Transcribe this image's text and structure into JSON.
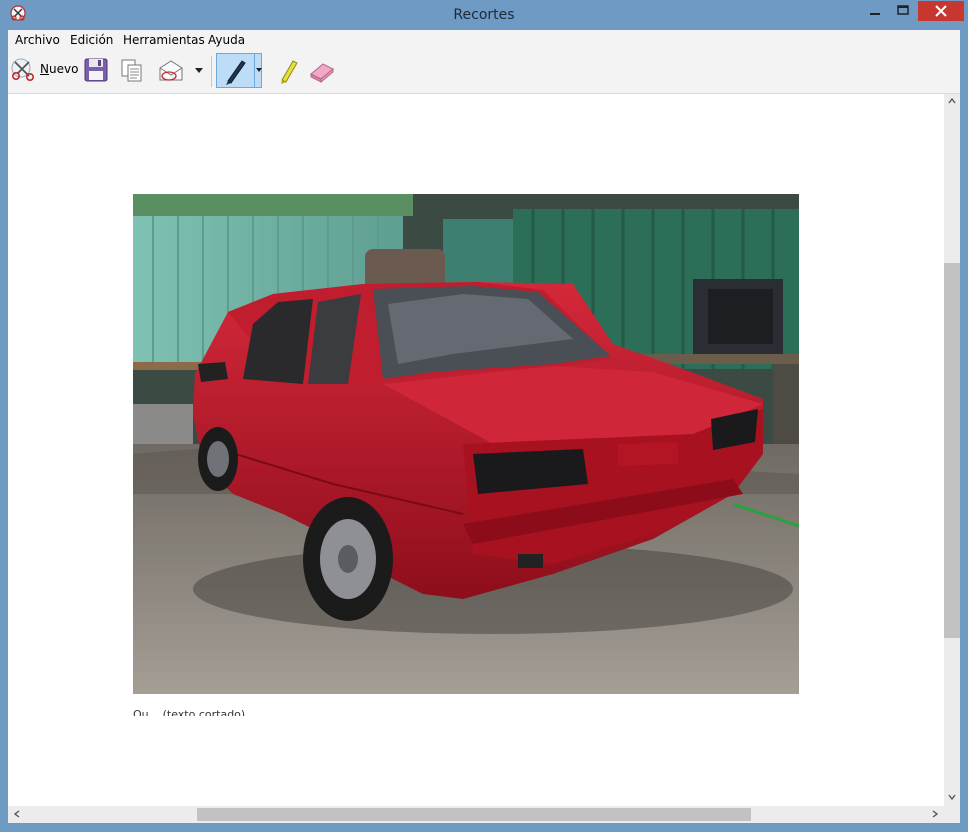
{
  "window": {
    "title": "Recortes"
  },
  "menu": [
    "Archivo",
    "Edición",
    "Herramientas",
    "Ayuda"
  ],
  "toolbar": {
    "nuevo_label": "Nuevo",
    "nuevo_underline": "N",
    "nuevo_rest": "uevo",
    "active_tool": "pen-icon"
  },
  "canvas": {
    "caption_partial": "Qu...  (texto cortado)"
  },
  "colors": {
    "titlebar": "#6f9ac3",
    "close": "#c7372f",
    "pen_active_bg": "#bcdcf7",
    "car_red": "#b3121e"
  }
}
